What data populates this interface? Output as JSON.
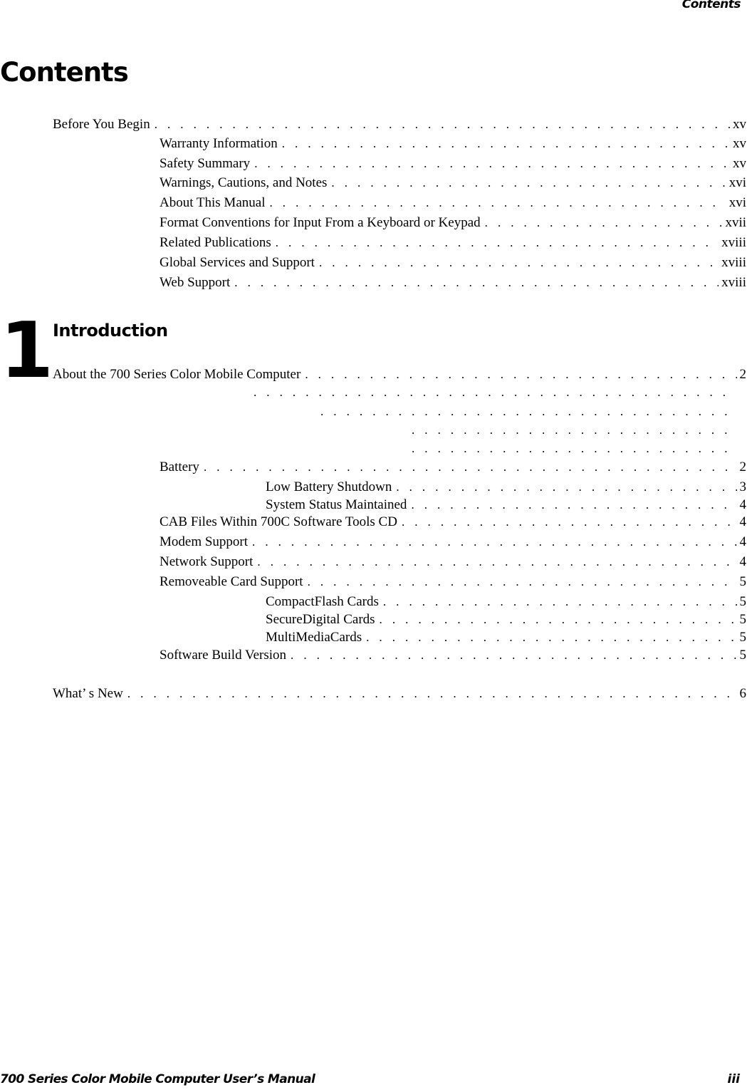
{
  "header": {
    "running_title": "Contents"
  },
  "page_title": "Contents",
  "front_matter": {
    "entry": {
      "label": "Before You Begin",
      "page": "xv"
    },
    "subentries": [
      {
        "label": "Warranty Information",
        "page": "xv"
      },
      {
        "label": "Safety Summary",
        "page": "xv"
      },
      {
        "label": "Warnings, Cautions, and Notes",
        "page": "xvi"
      },
      {
        "label": "About This Manual",
        "page": "xvi"
      },
      {
        "label": "Format Conventions for Input From a Keyboard or Keypad",
        "page": "xvii"
      },
      {
        "label": "Related Publications",
        "page": "xviii"
      },
      {
        "label": "Global Services and Support",
        "page": "xviii"
      },
      {
        "label": "Web Support",
        "page": "xviii"
      }
    ]
  },
  "chapter1": {
    "number": "1",
    "title": "Introduction",
    "entries": [
      {
        "label": "About the 700 Series Color Mobile Computer",
        "page": "2"
      },
      {
        "label": "Battery",
        "page": "2"
      },
      {
        "label": "Low Battery Shutdown",
        "page": "3"
      },
      {
        "label": "System Status Maintained",
        "page": "4"
      },
      {
        "label": "CAB Files Within 700C Software Tools CD",
        "page": "4"
      },
      {
        "label": "Modem Support",
        "page": "4"
      },
      {
        "label": "Network Support",
        "page": "4"
      },
      {
        "label": "Removeable Card Support",
        "page": "5"
      },
      {
        "label": "CompactFlash Cards",
        "page": "5"
      },
      {
        "label": "SecureDigital Cards",
        "page": "5"
      },
      {
        "label": "MultiMediaCards",
        "page": "5"
      },
      {
        "label": "Software Build Version",
        "page": "5"
      },
      {
        "label": "What’ s New",
        "page": "6"
      }
    ]
  },
  "footer": {
    "manual_title": "700 Series Color Mobile Computer User’s Manual",
    "page_number": "iii"
  }
}
